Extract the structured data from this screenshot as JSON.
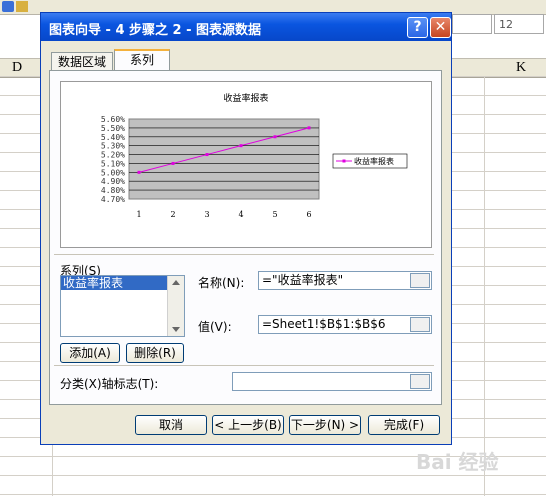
{
  "background": {
    "col_d": "D",
    "col_k": "K",
    "font_size_value": "12"
  },
  "dialog": {
    "title": "图表向导 - 4 步骤之 2 - 图表源数据",
    "help_glyph": "?",
    "close_glyph": "✕",
    "tabs": [
      {
        "label": "数据区域",
        "active": false
      },
      {
        "label": "系列",
        "active": true
      }
    ],
    "series_label": "系列(S)",
    "series_items": [
      "收益率报表"
    ],
    "add_button": "添加(A)",
    "remove_button": "删除(R)",
    "name_label": "名称(N):",
    "name_value": "=\"收益率报表\"",
    "value_label": "值(V):",
    "value_value": "=Sheet1!$B$1:$B$6",
    "category_label": "分类(X)轴标志(T):",
    "category_value": "",
    "buttons": {
      "cancel": "取消",
      "back": "< 上一步(B)",
      "next": "下一步(N) >",
      "finish": "完成(F)"
    }
  },
  "chart_data": {
    "type": "line",
    "title": "收益率报表",
    "x": [
      1,
      2,
      3,
      4,
      5,
      6
    ],
    "series": [
      {
        "name": "收益率报表",
        "values": [
          0.05,
          0.051,
          0.052,
          0.053,
          0.054,
          0.055
        ],
        "color": "#e000e0"
      }
    ],
    "y_ticks": [
      "5.60%",
      "5.50%",
      "5.40%",
      "5.30%",
      "5.20%",
      "5.10%",
      "5.00%",
      "4.90%",
      "4.80%",
      "4.70%"
    ],
    "ylim": [
      0.047,
      0.056
    ],
    "grid": true,
    "plot_background": "#c0c0c0",
    "legend_position": "right"
  },
  "watermark": "Bai 经验"
}
